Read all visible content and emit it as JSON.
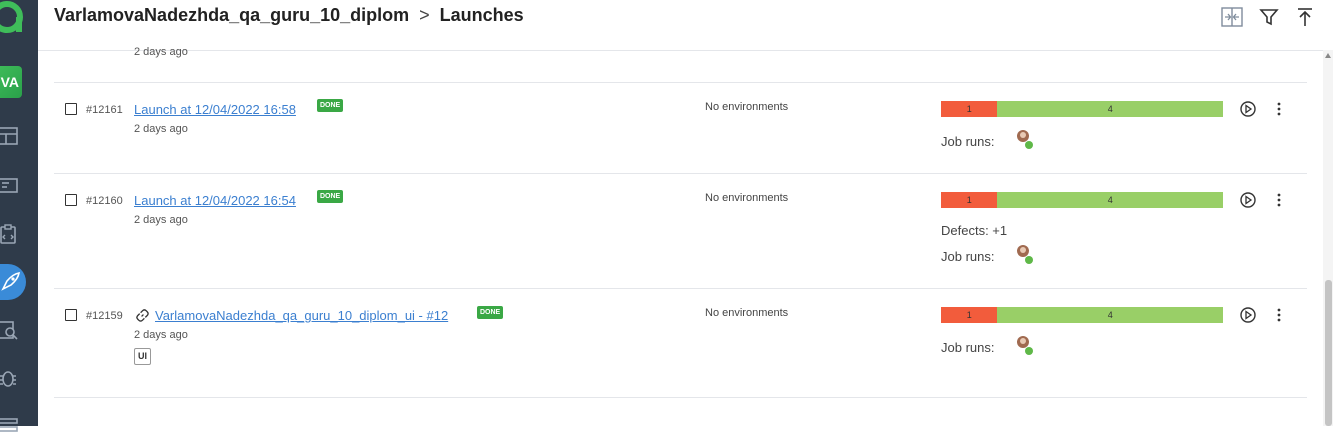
{
  "sidebar": {
    "avatar_initials": "VA",
    "icons": [
      "dashboard-icon",
      "test-cases-icon",
      "test-plans-icon",
      "launches-icon",
      "analytics-icon",
      "defects-icon",
      "settings-icon"
    ]
  },
  "header": {
    "project": "VarlamovaNadezhda_qa_guru_10_diplom",
    "separator": ">",
    "page": "Launches"
  },
  "launches": [
    {
      "ago": "2 days ago"
    },
    {
      "id": "#12161",
      "name": "Launch at 12/04/2022 16:58",
      "status": "DONE",
      "ago": "2 days ago",
      "env": "No environments",
      "failed": "1",
      "passed": "4",
      "failed_fraction": 0.2,
      "job_runs_label": "Job runs:"
    },
    {
      "id": "#12160",
      "name": "Launch at 12/04/2022 16:54",
      "status": "DONE",
      "ago": "2 days ago",
      "env": "No environments",
      "failed": "1",
      "passed": "4",
      "failed_fraction": 0.2,
      "defects": "Defects: +1",
      "job_runs_label": "Job runs:"
    },
    {
      "id": "#12159",
      "name": "VarlamovaNadezhda_qa_guru_10_diplom_ui - #12",
      "status": "DONE",
      "ago": "2 days ago",
      "tag": "UI",
      "env": "No environments",
      "failed": "1",
      "passed": "4",
      "failed_fraction": 0.2,
      "job_runs_label": "Job runs:"
    }
  ],
  "colors": {
    "sidebar_bg": "#2f3b4a",
    "accent": "#3a8bd8",
    "failed": "#f25c3c",
    "passed": "#99cf67",
    "done_badge": "#3aa845",
    "link": "#3b7fd0"
  }
}
